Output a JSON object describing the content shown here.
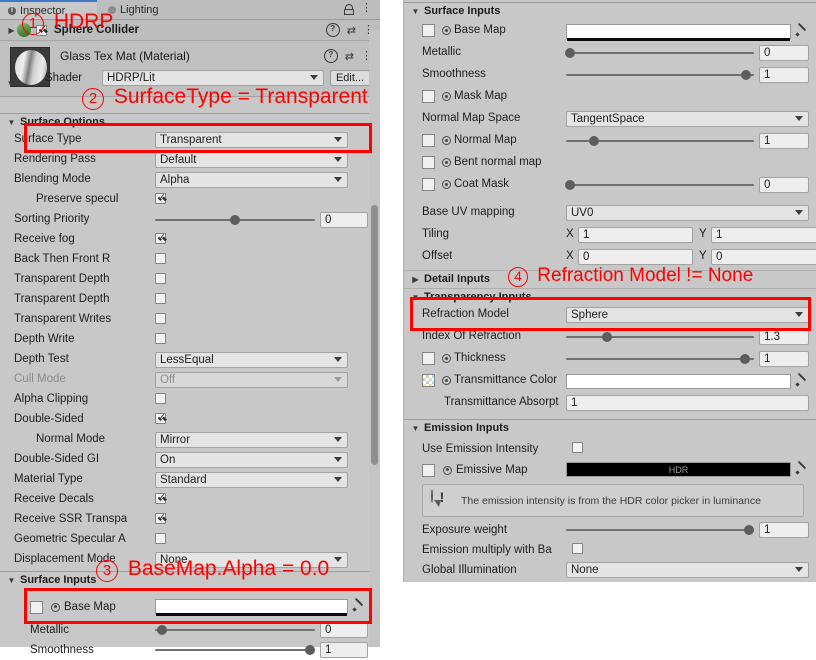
{
  "window": {
    "tabs": [
      {
        "label": "Inspector",
        "icon": "info-icon",
        "active": true
      },
      {
        "label": "Lighting",
        "icon": "lighting-dot-icon",
        "active": false
      }
    ],
    "lock_icon": "lock-icon",
    "menu_icon": "kebab-menu-icon"
  },
  "colors": {
    "panel_bg": "#c8c8c8",
    "header_bg": "#bdbdbd",
    "field_bg": "#e4e4e4",
    "accent_blue": "#3b78c8",
    "annotation_red": "#ff0000"
  },
  "component": {
    "name": "Sphere Collider",
    "enabled": true,
    "help_icon": "help-icon",
    "preset_icon": "preset-icon",
    "menu_icon": "kebab-menu-icon"
  },
  "material": {
    "title": "Glass Tex Mat (Material)",
    "shader_label": "Shader",
    "shader_value": "HDRP/Lit",
    "edit_button": "Edit...",
    "help_icon": "help-icon",
    "preset_icon": "preset-icon",
    "menu_icon": "kebab-menu-icon"
  },
  "left_panel": {
    "surface_options": {
      "header": "Surface Options",
      "rows": [
        {
          "label": "Surface Type",
          "type": "dropdown",
          "value": "Transparent"
        },
        {
          "label": "Rendering Pass",
          "type": "dropdown",
          "value": "Default"
        },
        {
          "label": "Blending Mode",
          "type": "dropdown",
          "value": "Alpha"
        },
        {
          "label": "Preserve specul",
          "type": "checkbox",
          "value": true,
          "indent": 1
        },
        {
          "label": "Sorting Priority",
          "type": "slider",
          "value": "0",
          "pos": 0.5
        },
        {
          "label": "Receive fog",
          "type": "checkbox",
          "value": true
        },
        {
          "label": "Back Then Front R",
          "type": "checkbox",
          "value": false
        },
        {
          "label": "Transparent Depth",
          "type": "checkbox",
          "value": false
        },
        {
          "label": "Transparent Depth",
          "type": "checkbox",
          "value": false
        },
        {
          "label": "Transparent Writes",
          "type": "checkbox",
          "value": false
        },
        {
          "label": "Depth Write",
          "type": "checkbox",
          "value": false
        },
        {
          "label": "Depth Test",
          "type": "dropdown",
          "value": "LessEqual"
        },
        {
          "label": "Cull Mode",
          "type": "dropdown",
          "value": "Off",
          "disabled": true
        },
        {
          "label": "Alpha Clipping",
          "type": "checkbox",
          "value": false
        },
        {
          "label": "Double-Sided",
          "type": "checkbox",
          "value": true
        },
        {
          "label": "Normal Mode",
          "type": "dropdown",
          "value": "Mirror",
          "indent": 1
        },
        {
          "label": "Double-Sided GI",
          "type": "dropdown",
          "value": "On"
        },
        {
          "label": "Material Type",
          "type": "dropdown",
          "value": "Standard"
        },
        {
          "label": "Receive Decals",
          "type": "checkbox",
          "value": true
        },
        {
          "label": "Receive SSR Transpa",
          "type": "checkbox",
          "value": true
        },
        {
          "label": "Geometric Specular A",
          "type": "checkbox",
          "value": false
        },
        {
          "label": "Displacement Mode",
          "type": "dropdown",
          "value": "None"
        }
      ]
    },
    "surface_inputs": {
      "header": "Surface Inputs",
      "base_map_label": "Base Map",
      "metallic_label": "Metallic",
      "metallic_value": "0",
      "smoothness_label": "Smoothness",
      "smoothness_value": "1",
      "eyedropper_icon": "eyedropper-icon"
    }
  },
  "right_panel": {
    "surface_inputs": {
      "header": "Surface Inputs",
      "rows": [
        {
          "label": "Base Map",
          "type": "texture-color",
          "swatch": "white",
          "eyedropper": true
        },
        {
          "label": "Metallic",
          "type": "slider",
          "value": "0",
          "pos": 0.02
        },
        {
          "label": "Smoothness",
          "type": "slider",
          "value": "1",
          "pos": 0.96
        },
        {
          "label": "Mask Map",
          "type": "texture"
        },
        {
          "label": "Normal Map Space",
          "type": "dropdown",
          "value": "TangentSpace"
        },
        {
          "label": "Normal Map",
          "type": "texture-slider",
          "value": "1",
          "pos": 0.15
        },
        {
          "label": "Bent normal map",
          "type": "texture"
        },
        {
          "label": "Coat Mask",
          "type": "texture-slider",
          "value": "0",
          "pos": 0.02
        },
        {
          "label": "Base UV mapping",
          "type": "dropdown",
          "value": "UV0"
        },
        {
          "label": "Tiling",
          "type": "vector2",
          "x_label": "X",
          "x_value": "1",
          "y_label": "Y",
          "y_value": "1"
        },
        {
          "label": "Offset",
          "type": "vector2",
          "x_label": "X",
          "x_value": "0",
          "y_label": "Y",
          "y_value": "0"
        }
      ]
    },
    "detail_inputs": {
      "header": "Detail Inputs",
      "collapsed": true
    },
    "transparency_inputs": {
      "header": "Transparency Inputs",
      "rows": [
        {
          "label": "Refraction Model",
          "type": "dropdown",
          "value": "Sphere"
        },
        {
          "label": "Index Of Refraction",
          "type": "slider",
          "value": "1.3",
          "pos": 0.22
        },
        {
          "label": "Thickness",
          "type": "texture-slider",
          "value": "1",
          "pos": 0.95
        },
        {
          "label": "Transmittance Color",
          "type": "checker-color",
          "eyedropper": true
        },
        {
          "label": "Transmittance Absorpt",
          "type": "field",
          "value": "1"
        }
      ]
    },
    "emission_inputs": {
      "header": "Emission Inputs",
      "use_emission_intensity_label": "Use Emission Intensity",
      "use_emission_intensity_value": false,
      "emissive_map_label": "Emissive Map",
      "emissive_map_badge": "HDR",
      "help_text": "The emission intensity is from the HDR color picker in luminance",
      "help_icon": "warning-icon",
      "exposure_weight_label": "Exposure weight",
      "exposure_weight_value": "1",
      "emission_multiply_label": "Emission multiply with Ba",
      "emission_multiply_value": false,
      "global_illumination_label": "Global Illumination",
      "global_illumination_value": "None",
      "eyedropper_icon": "eyedropper-icon"
    }
  },
  "annotations": [
    {
      "id": "1",
      "text": "HDRP"
    },
    {
      "id": "2",
      "text": "SurfaceType = Transparent"
    },
    {
      "id": "3",
      "text": "BaseMap.Alpha = 0.0"
    },
    {
      "id": "4",
      "text": "Refraction Model != None"
    }
  ]
}
